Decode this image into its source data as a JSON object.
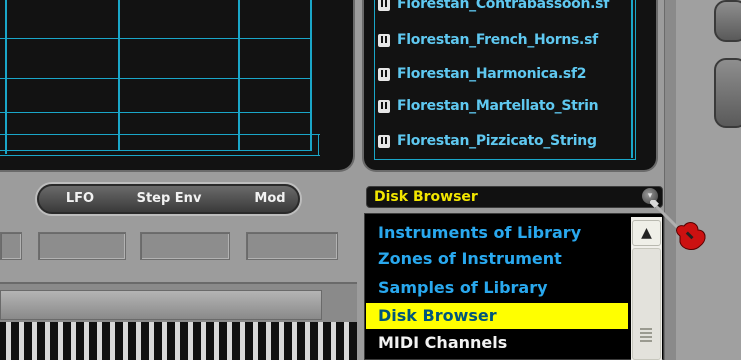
{
  "file_list": {
    "items": [
      "Florestan_Contrabassoon.sf",
      "Florestan_French_Horns.sf",
      "Florestan_Harmonica.sf2",
      "Florestan_Martellato_Strin",
      "Florestan_Pizzicato_String"
    ],
    "icon": "sf2-file-icon"
  },
  "tabs": [
    "LFO",
    "Step Env",
    "Mod"
  ],
  "disk_browser": {
    "selected_label": "Disk Browser",
    "options": [
      "Instruments of Library",
      "Zones of Instrument",
      "Samples of Library",
      "Disk Browser",
      "MIDI Channels"
    ],
    "selected_index": 3
  },
  "cursor": {
    "icon": "guitar-cursor-icon"
  },
  "colors": {
    "display_bg": "#121212",
    "display_accent": "#1aa6c8",
    "list_text": "#29a8ee",
    "selection_bg": "#ffff00",
    "header_text": "#f2e600"
  }
}
